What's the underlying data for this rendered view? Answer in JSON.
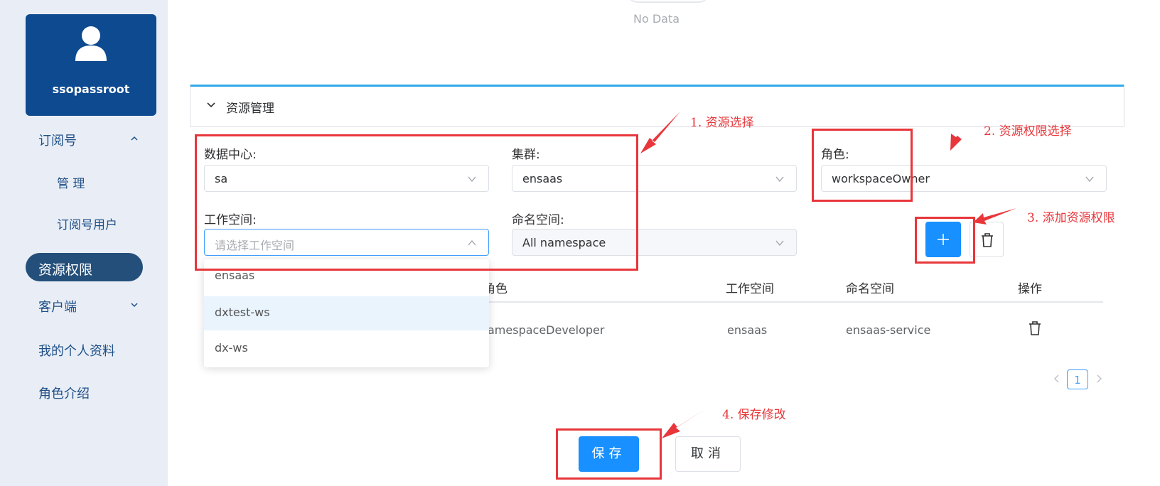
{
  "user": {
    "name": "ssopassroot",
    "avatar_icon": "user-icon"
  },
  "sidebar": {
    "items": [
      {
        "label": "订阅号",
        "chevron": "chevron-up-icon"
      },
      {
        "label": "管 理"
      },
      {
        "label": "订阅号用户"
      },
      {
        "label": "资源权限",
        "active": true
      },
      {
        "label": "客户端",
        "chevron": "chevron-down-icon"
      },
      {
        "label": "我的个人资料"
      },
      {
        "label": "角色介绍"
      }
    ]
  },
  "main": {
    "no_data": "No Data",
    "panel_title": "资源管理",
    "form": {
      "datacenter": {
        "label": "数据中心:",
        "value": "sa"
      },
      "cluster": {
        "label": "集群:",
        "value": "ensaas"
      },
      "role": {
        "label": "角色:",
        "value": "workspaceOwner"
      },
      "workspace": {
        "label": "工作空间:",
        "placeholder": "请选择工作空间",
        "value": ""
      },
      "namespace": {
        "label": "命名空间:",
        "value": "All namespace",
        "disabled": true
      }
    },
    "dropdown_options": [
      "ensaas",
      "dxtest-ws",
      "dx-ws"
    ],
    "table": {
      "columns": [
        "角色",
        "工作空间",
        "命名空间",
        "操作"
      ],
      "rows": [
        {
          "role": "amespaceDeveloper",
          "workspace": "ensaas",
          "namespace": "ensaas-service"
        }
      ]
    },
    "pagination": {
      "current": "1"
    },
    "buttons": {
      "save": "保存",
      "cancel": "取消"
    }
  },
  "annotations": {
    "step1": "1.  资源选择",
    "step2": "2.  资源权限选择",
    "step3": "3.  添加资源权限",
    "step4": "4.  保存修改"
  },
  "colors": {
    "primary": "#1890ff",
    "sidebar_bg": "#e9eef6",
    "user_card": "#0d4a8f",
    "annotation": "#e8363a",
    "active_nav": "#244f7a"
  }
}
